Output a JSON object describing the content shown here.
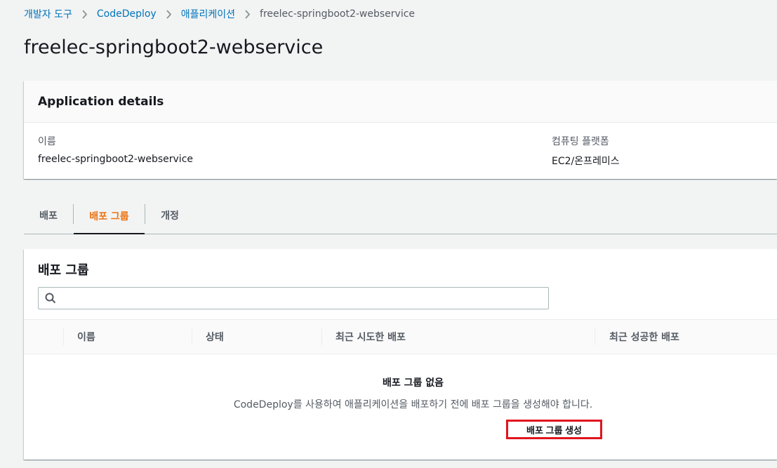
{
  "breadcrumb": {
    "items": [
      "개발자 도구",
      "CodeDeploy",
      "애플리케이션"
    ],
    "current": "freelec-springboot2-webservice"
  },
  "page_title": "freelec-springboot2-webservice",
  "details": {
    "header": "Application details",
    "name_label": "이름",
    "name_value": "freelec-springboot2-webservice",
    "platform_label": "컴퓨팅 플랫폼",
    "platform_value": "EC2/온프레미스"
  },
  "tabs": [
    {
      "label": "배포",
      "active": false
    },
    {
      "label": "배포 그룹",
      "active": true
    },
    {
      "label": "개정",
      "active": false
    }
  ],
  "deployment_groups": {
    "title": "배포 그룹",
    "search_placeholder": "",
    "columns": [
      "이름",
      "상태",
      "최근 시도한 배포",
      "최근 성공한 배포"
    ],
    "empty_title": "배포 그룹 없음",
    "empty_desc": "CodeDeploy를 사용하여 애플리케이션을 배포하기 전에 배포 그룹을 생성해야 합니다.",
    "create_button": "배포 그룹 생성"
  },
  "colors": {
    "link": "#0073bb",
    "active_tab": "#ec7211",
    "highlight_border": "#e1141e"
  }
}
